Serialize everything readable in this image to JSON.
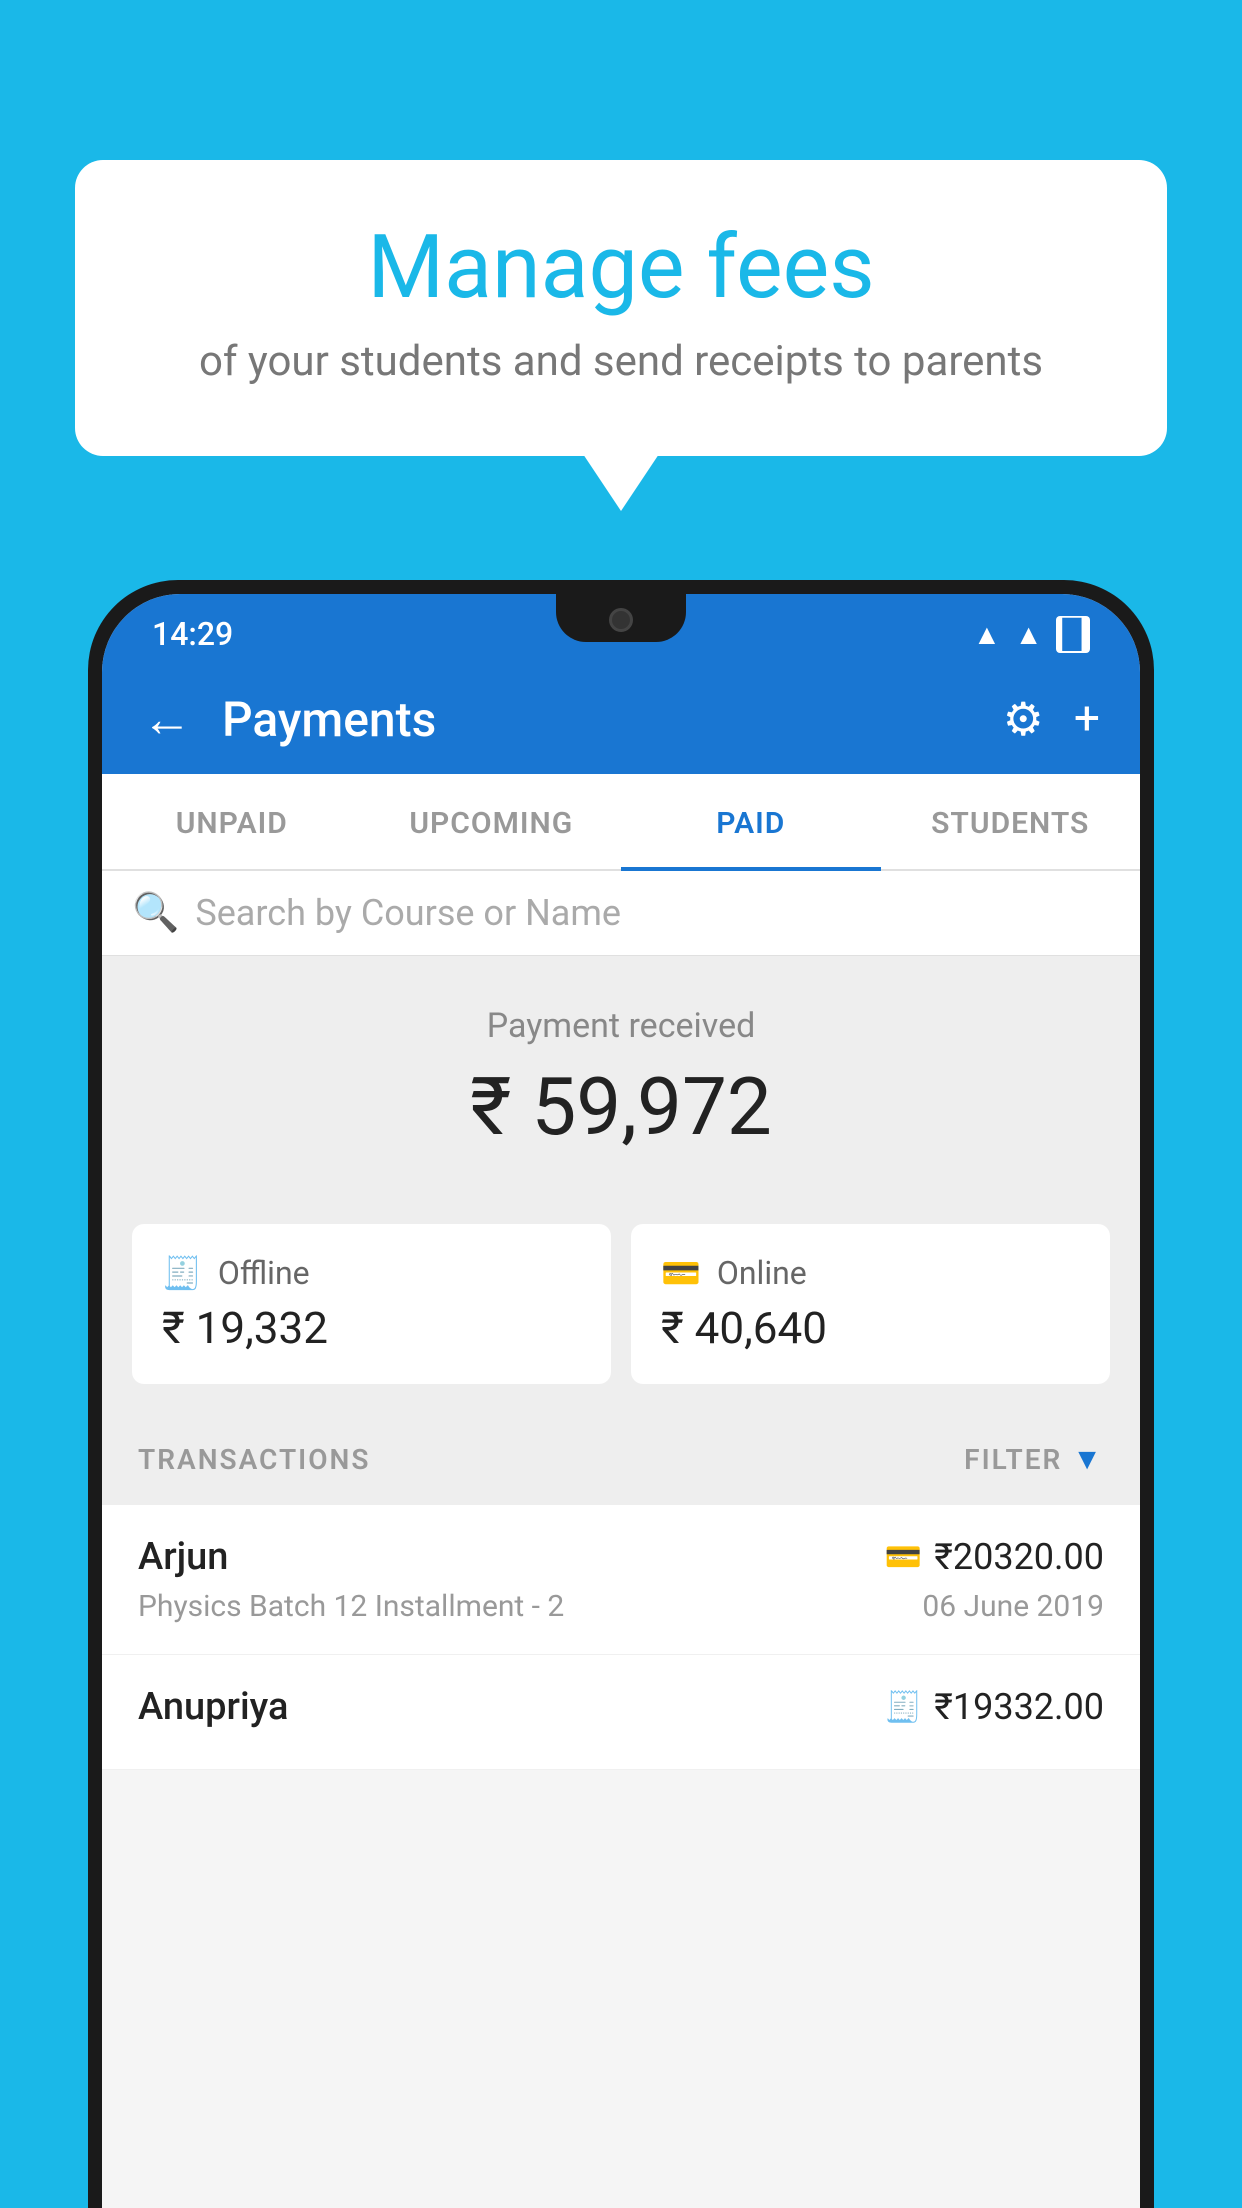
{
  "background_color": "#1ab8e8",
  "bubble": {
    "title": "Manage fees",
    "subtitle": "of your students and send receipts to parents"
  },
  "status_bar": {
    "time": "14:29",
    "wifi": "▲",
    "signal": "▲",
    "battery": "▉"
  },
  "app_bar": {
    "title": "Payments",
    "back_icon": "←",
    "gear_icon": "⚙",
    "plus_icon": "+"
  },
  "tabs": [
    {
      "label": "UNPAID",
      "active": false
    },
    {
      "label": "UPCOMING",
      "active": false
    },
    {
      "label": "PAID",
      "active": true
    },
    {
      "label": "STUDENTS",
      "active": false
    }
  ],
  "search": {
    "placeholder": "Search by Course or Name",
    "icon": "🔍"
  },
  "payment_received": {
    "label": "Payment received",
    "amount": "₹ 59,972"
  },
  "cards": [
    {
      "icon": "📄",
      "label": "Offline",
      "amount": "₹ 19,332"
    },
    {
      "icon": "💳",
      "label": "Online",
      "amount": "₹ 40,640"
    }
  ],
  "transactions_label": "TRANSACTIONS",
  "filter_label": "FILTER",
  "transactions": [
    {
      "name": "Arjun",
      "amount": "₹20320.00",
      "payment_type": "card",
      "description": "Physics Batch 12 Installment - 2",
      "date": "06 June 2019"
    },
    {
      "name": "Anupriya",
      "amount": "₹19332.00",
      "payment_type": "offline",
      "description": "",
      "date": ""
    }
  ]
}
